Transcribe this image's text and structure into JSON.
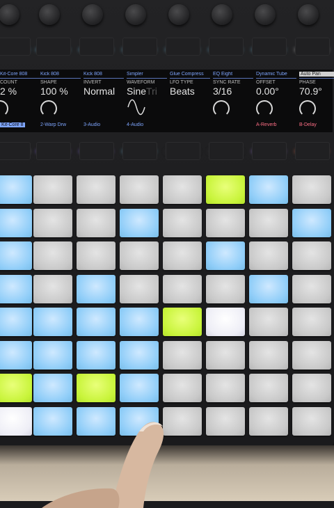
{
  "display": {
    "columns": [
      {
        "device": "Kit-Core 808",
        "param": "COUNT",
        "value": "2 %",
        "track": "Kit-Core 8",
        "device_selected": false,
        "track_style": "sel"
      },
      {
        "device": "Kick 808",
        "param": "SHAPE",
        "value": "100 %",
        "track": "2-Warp Drw",
        "device_selected": false,
        "track_style": "normal"
      },
      {
        "device": "Kick 808",
        "param": "INVERT",
        "value": "Normal",
        "track": "3-Audio",
        "device_selected": false,
        "track_style": "normal"
      },
      {
        "device": "Simpler",
        "param": "WAVEFORM",
        "value": "Sine",
        "value_dim": "Tri",
        "track": "4-Audio",
        "device_selected": false,
        "track_style": "normal"
      },
      {
        "device": "Glue Compress",
        "param": "LFO TYPE",
        "value": "Beats",
        "track": "",
        "device_selected": false,
        "track_style": "normal"
      },
      {
        "device": "EQ Eight",
        "param": "SYNC RATE",
        "value": "3/16",
        "track": "",
        "device_selected": false,
        "track_style": "normal"
      },
      {
        "device": "Dynamic Tube",
        "param": "OFFSET",
        "value": "0.00°",
        "track": "A-Reverb",
        "device_selected": false,
        "track_style": "red"
      },
      {
        "device": "Auto Pan",
        "param": "PHASE",
        "value": "70.9°",
        "track": "B-Delay",
        "device_selected": true,
        "track_style": "red"
      }
    ]
  },
  "top_strip_colors": [
    "#5ec8ff",
    "#7ed4ff",
    "#7ed4ff",
    "#7ed4ff",
    "#7ed4ff",
    "#7ed4ff",
    "#7ed4ff",
    "#f4f4f4"
  ],
  "lower_strip_colors": [
    "#f4f4f4",
    "#9a7bff",
    "#9a7bff",
    "#7ed4ff",
    "#3a3a3c",
    "#3a3a3c",
    "#b48cff",
    "#ff7a55"
  ],
  "pads": [
    [
      "blue",
      "grey",
      "grey",
      "grey",
      "grey",
      "green",
      "blue",
      "grey"
    ],
    [
      "blue",
      "grey",
      "grey",
      "blue",
      "grey",
      "grey",
      "grey",
      "blue"
    ],
    [
      "blue",
      "grey",
      "grey",
      "grey",
      "grey",
      "blue",
      "grey",
      "grey"
    ],
    [
      "blue",
      "grey",
      "blue",
      "grey",
      "grey",
      "grey",
      "blue",
      "grey"
    ],
    [
      "blue",
      "blue",
      "blue",
      "blue",
      "green",
      "white",
      "grey",
      "grey"
    ],
    [
      "blue",
      "blue",
      "blue",
      "blue",
      "grey",
      "grey",
      "grey",
      "grey"
    ],
    [
      "green",
      "blue",
      "green",
      "blue",
      "grey",
      "grey",
      "grey",
      "grey"
    ],
    [
      "white",
      "blue",
      "blue",
      "blue",
      "grey",
      "grey",
      "grey",
      "grey"
    ]
  ]
}
